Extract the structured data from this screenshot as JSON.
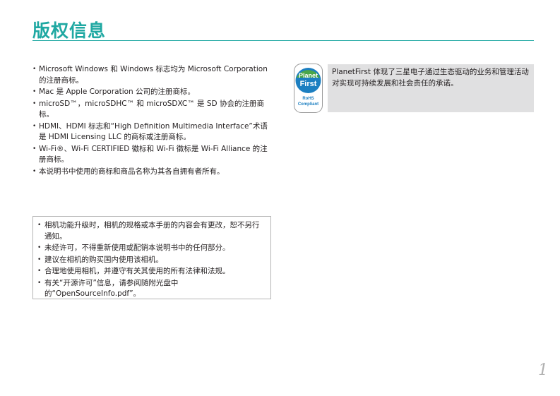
{
  "page": {
    "title": "版权信息",
    "page_number": "1"
  },
  "trademarks": [
    "Microsoft Windows 和 Windows 标志均为 Microsoft Corporation 的注册商标。",
    "Mac 是 Apple Corporation 公司的注册商标。",
    "microSD™，microSDHC™ 和 microSDXC™ 是 SD 协会的注册商标。",
    "HDMI、HDMI 标志和“High Definition Multimedia Interface”术语是 HDMI Licensing LLC 的商标或注册商标。",
    "Wi-Fi®、Wi-Fi CERTIFIED 徽标和 Wi-Fi 徽标是 Wi-Fi Alliance 的注册商标。",
    "本说明书中使用的商标和商品名称为其各自拥有者所有。"
  ],
  "notices": [
    "相机功能升级时，相机的规格或本手册的内容会有更改，恕不另行通知。",
    "未经许可，不得重新使用或配销本说明书中的任何部分。",
    "建议在相机的购买国内使用该相机。",
    "合理地使用相机，并遵守有关其使用的所有法律和法规。",
    "有关“开源许可”信息，请参阅随附光盘中的“OpenSourceInfo.pdf”。"
  ],
  "planet_first": {
    "badge_line1": "Planet",
    "badge_line2": "First",
    "badge_line3": "RoHS",
    "badge_line4": "Compliant",
    "description": "PlanetFirst 体现了三星电子通过生态驱动的业务和管理活动对实现可持续发展和社会责任的承诺。"
  },
  "colors": {
    "accent": "#1fa8a2",
    "panel_bg": "#e0e0e1",
    "badge_green": "#4aa64a",
    "badge_blue": "#1c7fc1"
  }
}
